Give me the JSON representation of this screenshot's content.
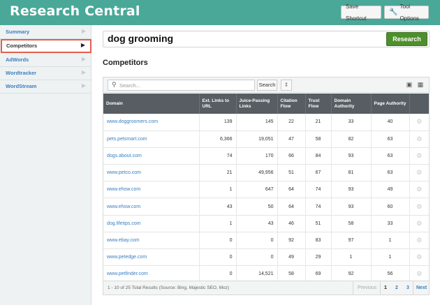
{
  "header": {
    "title": "Research Central",
    "save_shortcut_label": "Save Shortcut",
    "tool_options_label": "Tool Options"
  },
  "sidebar": {
    "items": [
      {
        "label": "Summary"
      },
      {
        "label": "Competitors"
      },
      {
        "label": "AdWords"
      },
      {
        "label": "Wordtracker"
      },
      {
        "label": "WordStream"
      }
    ]
  },
  "keyword": {
    "value": "dog grooming",
    "research_label": "Research"
  },
  "section": {
    "title": "Competitors"
  },
  "table": {
    "search_placeholder": "Search...",
    "search_label": "Search",
    "columns": [
      "Domain",
      "Ext. Links to URL",
      "Juice-Passing Links",
      "Citation Flow",
      "Trust Flow",
      "Domain Authority",
      "Page Authority"
    ],
    "rows": [
      [
        "www.doggroomers.com",
        "139",
        "145",
        "22",
        "21",
        "33",
        "40"
      ],
      [
        "pets.petsmart.com",
        "6,366",
        "19,051",
        "47",
        "58",
        "82",
        "63"
      ],
      [
        "dogs.about.com",
        "74",
        "170",
        "66",
        "84",
        "93",
        "63"
      ],
      [
        "www.petco.com",
        "21",
        "49,956",
        "51",
        "67",
        "81",
        "63"
      ],
      [
        "www.ehow.com",
        "1",
        "647",
        "64",
        "74",
        "93",
        "49"
      ],
      [
        "www.ehow.com",
        "43",
        "50",
        "64",
        "74",
        "93",
        "60"
      ],
      [
        "dog.lifetips.com",
        "1",
        "43",
        "46",
        "51",
        "58",
        "33"
      ],
      [
        "www.ebay.com",
        "0",
        "0",
        "92",
        "83",
        "97",
        "1"
      ],
      [
        "www.petedge.com",
        "0",
        "0",
        "49",
        "29",
        "1",
        "1"
      ],
      [
        "www.petfinder.com",
        "0",
        "14,521",
        "58",
        "69",
        "92",
        "56"
      ]
    ],
    "footer_text": "1 - 10 of 25 Total Results (Source: Bing, Majestic SEO, Moz)",
    "pagination": {
      "previous": "Previous",
      "pages": [
        "1",
        "2",
        "3"
      ],
      "next": "Next",
      "current": "1"
    }
  },
  "icons": {
    "search": "search-icon",
    "wrench": "wrench-icon",
    "gear": "gear-icon",
    "monitor": "monitor-icon",
    "export": "export-icon",
    "grid": "grid-icon"
  },
  "colors": {
    "header_bg": "#4aa898",
    "research_button": "#4e8f2d",
    "active_outline": "#e15f4d",
    "link": "#3a7fbf",
    "table_header": "#575d62"
  }
}
